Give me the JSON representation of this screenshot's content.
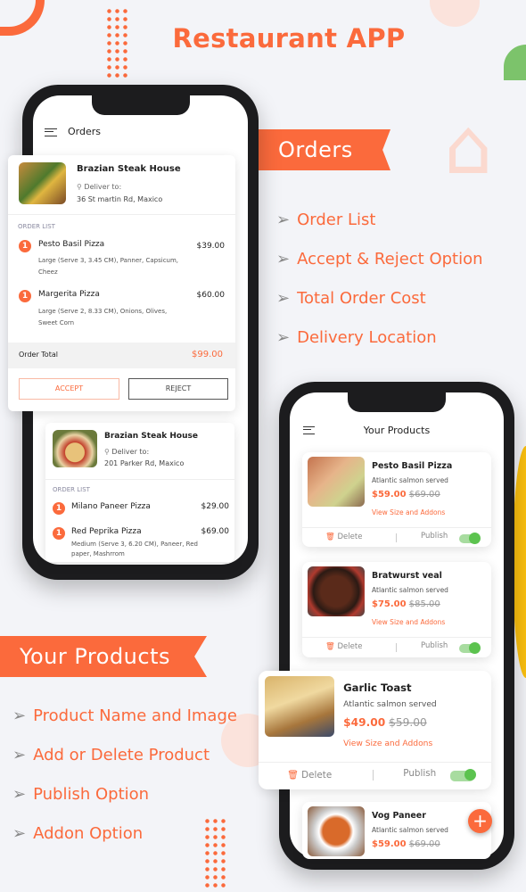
{
  "title": "Restaurant APP",
  "accent": "#fb6a3c",
  "orders_section": {
    "ribbon": "Orders",
    "features": [
      "Order List",
      "Accept & Reject Option",
      "Total Order Cost",
      "Delivery Location"
    ]
  },
  "products_section": {
    "ribbon": "Your Products",
    "features": [
      "Product Name and Image",
      "Add or Delete Product",
      "Publish Option",
      "Addon Option"
    ]
  },
  "orders_screen": {
    "header": "Orders",
    "orders": [
      {
        "restaurant": "Brazian Steak House",
        "deliver_label": "Deliver to:",
        "address": "36 St martin Rd, Maxico",
        "list_label": "ORDER LIST",
        "items": [
          {
            "qty": "1",
            "name": "Pesto Basil Pizza",
            "price": "$39.00",
            "desc": "Large (Serve 3, 3.45 CM), Panner, Capsicum, Cheez"
          },
          {
            "qty": "1",
            "name": "Margerita Pizza",
            "price": "$60.00",
            "desc": "Large (Serve 2, 8.33 CM), Onions, Olives, Sweet Corn"
          }
        ],
        "total_label": "Order Total",
        "total": "$99.00",
        "accept": "ACCEPT",
        "reject": "REJECT"
      },
      {
        "restaurant": "Brazian Steak House",
        "deliver_label": "Deliver to:",
        "address": "201 Parker Rd, Maxico",
        "list_label": "ORDER LIST",
        "items": [
          {
            "qty": "1",
            "name": "Milano Paneer Pizza",
            "price": "$29.00",
            "desc": ""
          },
          {
            "qty": "1",
            "name": "Red Peprika Pizza",
            "price": "$69.00",
            "desc": "Medium (Serve 3, 6.20 CM), Paneer, Red paper, Mashrrom"
          }
        ]
      }
    ]
  },
  "products_screen": {
    "header": "Your Products",
    "delete": "Delete",
    "publish": "Publish",
    "addons": "View Size and Addons",
    "products": [
      {
        "name": "Pesto Basil Pizza",
        "desc": "Atlantic salmon served",
        "price": "$59.00",
        "old_price": "$69.00",
        "published": true
      },
      {
        "name": "Bratwurst veal",
        "desc": "Atlantic salmon served",
        "price": "$75.00",
        "old_price": "$85.00",
        "published": true
      },
      {
        "name": "Garlic Toast",
        "desc": "Atlantic salmon served",
        "price": "$49.00",
        "old_price": "$59.00",
        "published": true
      },
      {
        "name": "Vog Paneer",
        "desc": "Atlantic salmon served",
        "price": "$59.00",
        "old_price": "$69.00"
      }
    ]
  }
}
